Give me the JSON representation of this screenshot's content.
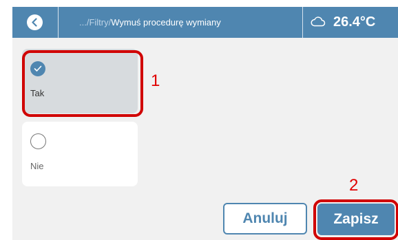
{
  "header": {
    "breadcrumb_path": ".../Filtry/",
    "breadcrumb_current": "Wymuś procedurę wymiany",
    "temperature": "26.4°C",
    "back_icon": "chevron-left-icon",
    "weather_icon": "cloud-icon"
  },
  "options": [
    {
      "label": "Tak",
      "selected": true
    },
    {
      "label": "Nie",
      "selected": false
    }
  ],
  "buttons": {
    "cancel_label": "Anuluj",
    "save_label": "Zapisz"
  },
  "annotations": {
    "marker_1": "1",
    "marker_2": "2"
  },
  "colors": {
    "accent": "#4f86b0",
    "highlight": "#d00000",
    "background": "#f1f1f1"
  }
}
